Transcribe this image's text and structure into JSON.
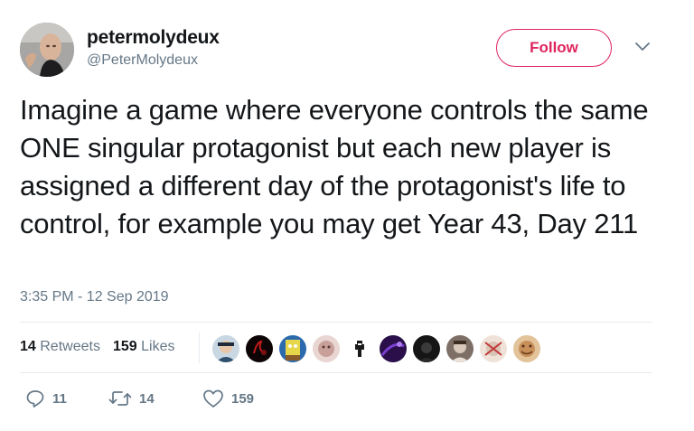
{
  "author": {
    "display_name": "petermolydeux",
    "handle": "@PeterMolydeux",
    "avatar_icon": "profile-photo"
  },
  "follow_button": {
    "label": "Follow",
    "color": "#e0245e"
  },
  "tweet": {
    "text": "Imagine a game where everyone controls the same ONE singular protagonist but each new player is assigned a different day of the protagonist's life to control, for example you may get Year 43, Day 211",
    "timestamp": "3:35 PM - 12 Sep 2019"
  },
  "stats": {
    "retweets_count": "14",
    "retweets_label": "Retweets",
    "likes_count": "159",
    "likes_label": "Likes"
  },
  "liker_avatars": [
    {
      "name": "liker-avatar-1",
      "color": "#7fa3c4"
    },
    {
      "name": "liker-avatar-2",
      "color": "#1b0a0a"
    },
    {
      "name": "liker-avatar-3",
      "color": "#2f6fb0"
    },
    {
      "name": "liker-avatar-4",
      "color": "#3fa6c9"
    },
    {
      "name": "liker-avatar-5",
      "color": "#d9bdb8"
    },
    {
      "name": "liker-avatar-6",
      "color": "#f5f5f5"
    },
    {
      "name": "liker-avatar-7",
      "color": "#2a0f4a"
    },
    {
      "name": "liker-avatar-8",
      "color": "#151515"
    },
    {
      "name": "liker-avatar-9",
      "color": "#8c7c72"
    },
    {
      "name": "liker-avatar-10",
      "color": "#e8d9d0"
    },
    {
      "name": "liker-avatar-11",
      "color": "#c9a07a"
    }
  ],
  "actions": {
    "reply_count": "11",
    "retweet_count": "14",
    "like_count": "159"
  },
  "colors": {
    "text_primary": "#14171a",
    "text_secondary": "#657786",
    "divider": "#e6ecf0"
  }
}
